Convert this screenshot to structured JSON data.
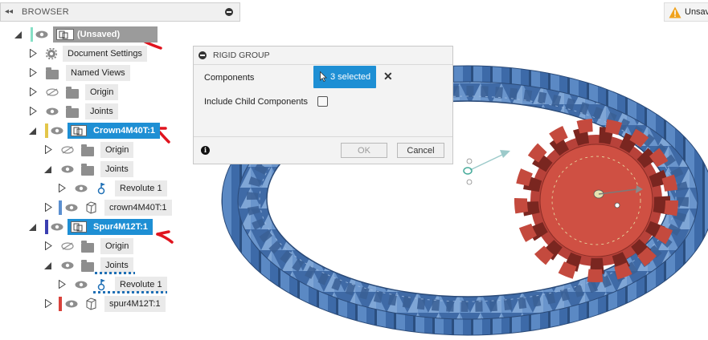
{
  "browser": {
    "title": "BROWSER",
    "root": {
      "label": "(Unsaved)"
    },
    "items": [
      {
        "label": "Document Settings"
      },
      {
        "label": "Named Views"
      },
      {
        "label": "Origin"
      },
      {
        "label": "Joints"
      },
      {
        "label": "Crown4M40T:1"
      },
      {
        "label": "Origin"
      },
      {
        "label": "Joints"
      },
      {
        "label": "Revolute 1"
      },
      {
        "label": "crown4M40T:1"
      },
      {
        "label": "Spur4M12T:1"
      },
      {
        "label": "Origin"
      },
      {
        "label": "Joints"
      },
      {
        "label": "Revolute 1"
      },
      {
        "label": "spur4M12T:1"
      }
    ]
  },
  "dialog": {
    "title": "RIGID GROUP",
    "components_label": "Components",
    "selection_text": "3 selected",
    "clear_label": "✕",
    "include_child_label": "Include Child Components",
    "include_child_checked": false,
    "ok_label": "OK",
    "cancel_label": "Cancel",
    "info_label": "i"
  },
  "warning": {
    "label": "Unsav"
  },
  "colors": {
    "accent": "#1e8fd4",
    "ring_gear": "#4f7fbf",
    "spur_gear": "#c9473a",
    "annotation": "#e0141e"
  }
}
